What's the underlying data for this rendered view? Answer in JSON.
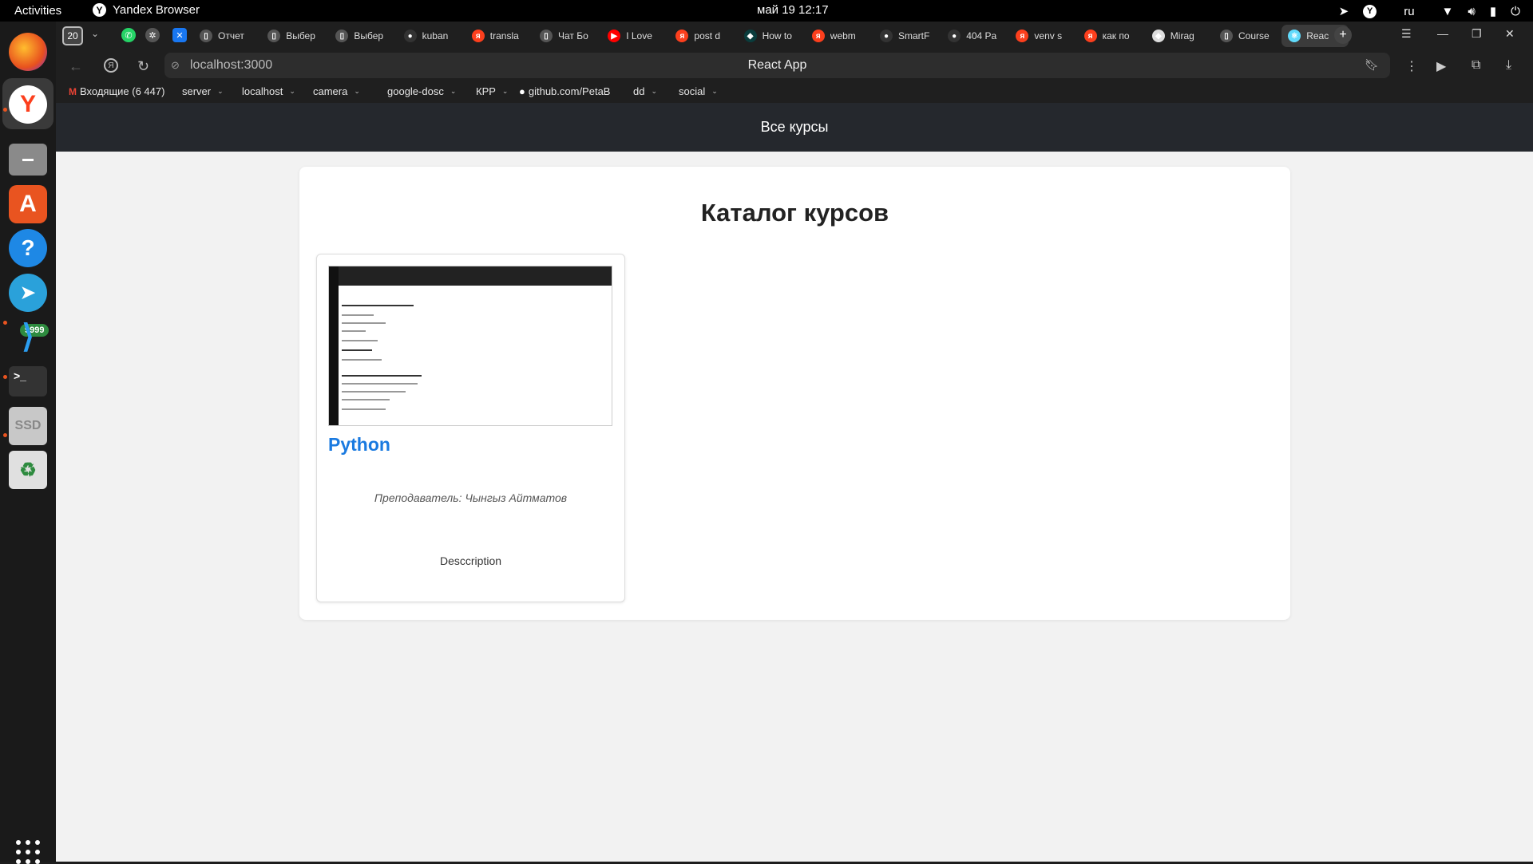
{
  "topbar": {
    "activities": "Activities",
    "app_name": "Yandex Browser",
    "clock": "май 19  12:17",
    "lang": "ru"
  },
  "dock": {
    "telegram_badge": "9999",
    "ssd_label": "SSD"
  },
  "browser": {
    "tab_count": "20",
    "tabs": [
      {
        "title": "Отчет",
        "icon": "document-icon",
        "color": "#555555"
      },
      {
        "title": "Выбер",
        "icon": "document-icon",
        "color": "#555555"
      },
      {
        "title": "Выбер",
        "icon": "document-icon",
        "color": "#555555"
      },
      {
        "title": "kuban",
        "icon": "github-icon",
        "color": "#333333"
      },
      {
        "title": "transla",
        "icon": "yandex-icon",
        "color": "#fc3f1d"
      },
      {
        "title": "Чат Бо",
        "icon": "document-icon",
        "color": "#555555"
      },
      {
        "title": "I Love",
        "icon": "youtube-icon",
        "color": "#ff0000"
      },
      {
        "title": "post d",
        "icon": "yandex-icon",
        "color": "#fc3f1d"
      },
      {
        "title": "How to",
        "icon": "site-icon",
        "color": "#0a3d3d"
      },
      {
        "title": "webm",
        "icon": "yandex-icon",
        "color": "#fc3f1d"
      },
      {
        "title": "SmartF",
        "icon": "github-icon",
        "color": "#333333"
      },
      {
        "title": "404 Pa",
        "icon": "github-icon",
        "color": "#333333"
      },
      {
        "title": "venv s",
        "icon": "yandex-icon",
        "color": "#fc3f1d"
      },
      {
        "title": "как по",
        "icon": "yandex-icon",
        "color": "#fc3f1d"
      },
      {
        "title": "Mirag",
        "icon": "site-icon",
        "color": "#dddddd"
      },
      {
        "title": "Course",
        "icon": "document-icon",
        "color": "#555555"
      },
      {
        "title": "Reac",
        "icon": "react-icon",
        "color": "#61dafb",
        "active": true
      }
    ],
    "url": "localhost:3000",
    "page_title": "React App",
    "bookmarks": [
      {
        "label": "Входящие (6 447)",
        "icon": "gmail-icon"
      },
      {
        "label": "server",
        "folder": true
      },
      {
        "label": "localhost",
        "folder": true
      },
      {
        "label": "camera",
        "folder": true
      },
      {
        "label": "google-dosc",
        "folder": true
      },
      {
        "label": "КРР",
        "folder": true
      },
      {
        "label": "github.com/PetaB",
        "icon": "github-icon"
      },
      {
        "label": "dd",
        "folder": true
      },
      {
        "label": "social",
        "folder": true
      }
    ]
  },
  "app": {
    "nav_title": "Все курсы",
    "catalog_title": "Каталог курсов",
    "courses": [
      {
        "title": "Python",
        "teacher": "Преподаватель: Чынгыз Айтматов",
        "description": "Desccription"
      }
    ]
  }
}
